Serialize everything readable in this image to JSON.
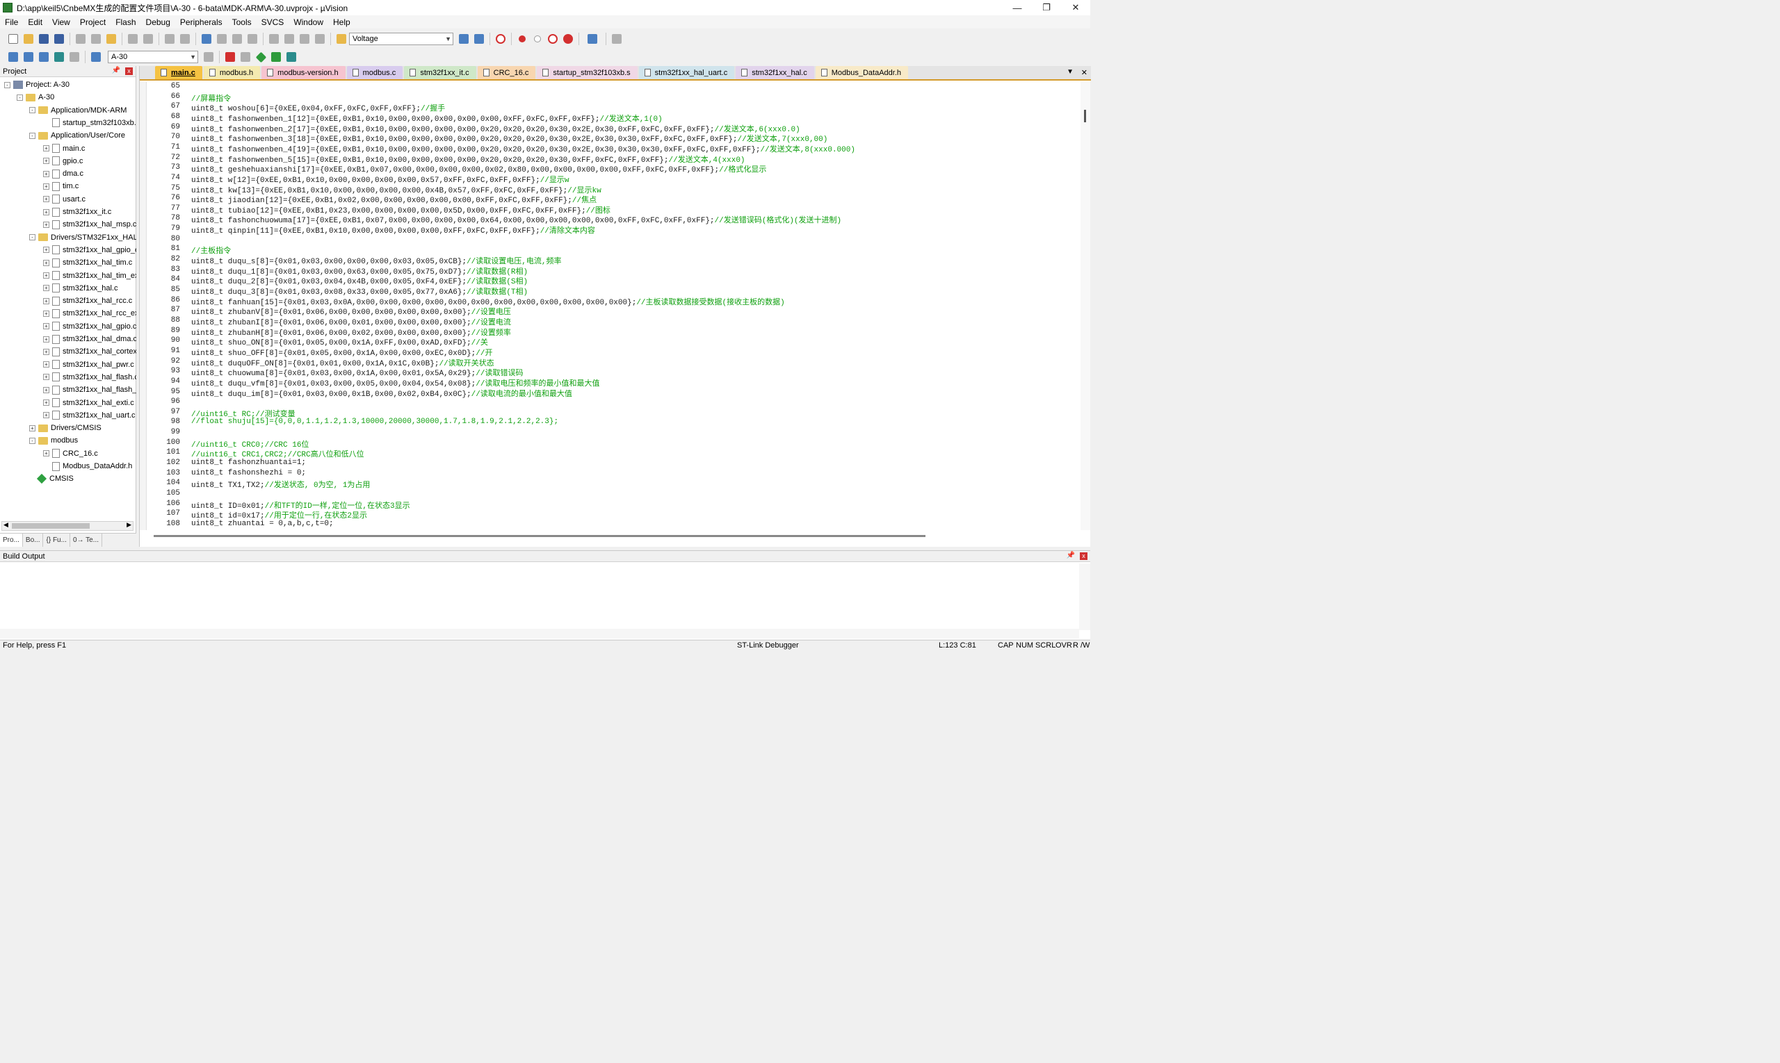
{
  "window": {
    "title": "D:\\app\\keil5\\CnbeMX生成的配置文件项目\\A-30 - 6-bata\\MDK-ARM\\A-30.uvprojx - µVision",
    "minimize": "—",
    "maximize": "❐",
    "close": "✕"
  },
  "menu": [
    "File",
    "Edit",
    "View",
    "Project",
    "Flash",
    "Debug",
    "Peripherals",
    "Tools",
    "SVCS",
    "Window",
    "Help"
  ],
  "toolbar": {
    "find_combo": "Voltage",
    "target_combo": "A-30"
  },
  "project_panel": {
    "title": "Project",
    "pin": "📌",
    "close": "x",
    "tree": [
      {
        "label": "Project: A-30",
        "level": 0,
        "type": "proj",
        "exp": "-"
      },
      {
        "label": "A-30",
        "level": 1,
        "type": "fold",
        "exp": "-"
      },
      {
        "label": "Application/MDK-ARM",
        "level": 2,
        "type": "fold",
        "exp": "-"
      },
      {
        "label": "startup_stm32f103xb.s",
        "level": 3,
        "type": "file",
        "exp": ""
      },
      {
        "label": "Application/User/Core",
        "level": 2,
        "type": "fold",
        "exp": "-"
      },
      {
        "label": "main.c",
        "level": 3,
        "type": "file",
        "exp": "+"
      },
      {
        "label": "gpio.c",
        "level": 3,
        "type": "file",
        "exp": "+"
      },
      {
        "label": "dma.c",
        "level": 3,
        "type": "file",
        "exp": "+"
      },
      {
        "label": "tim.c",
        "level": 3,
        "type": "file",
        "exp": "+"
      },
      {
        "label": "usart.c",
        "level": 3,
        "type": "file",
        "exp": "+"
      },
      {
        "label": "stm32f1xx_it.c",
        "level": 3,
        "type": "file",
        "exp": "+"
      },
      {
        "label": "stm32f1xx_hal_msp.c",
        "level": 3,
        "type": "file",
        "exp": "+"
      },
      {
        "label": "Drivers/STM32F1xx_HAL_Driver",
        "level": 2,
        "type": "fold",
        "exp": "-"
      },
      {
        "label": "stm32f1xx_hal_gpio_ex.c",
        "level": 3,
        "type": "file",
        "exp": "+"
      },
      {
        "label": "stm32f1xx_hal_tim.c",
        "level": 3,
        "type": "file",
        "exp": "+"
      },
      {
        "label": "stm32f1xx_hal_tim_ex.c",
        "level": 3,
        "type": "file",
        "exp": "+"
      },
      {
        "label": "stm32f1xx_hal.c",
        "level": 3,
        "type": "file",
        "exp": "+"
      },
      {
        "label": "stm32f1xx_hal_rcc.c",
        "level": 3,
        "type": "file",
        "exp": "+"
      },
      {
        "label": "stm32f1xx_hal_rcc_ex.c",
        "level": 3,
        "type": "file",
        "exp": "+"
      },
      {
        "label": "stm32f1xx_hal_gpio.c",
        "level": 3,
        "type": "file",
        "exp": "+"
      },
      {
        "label": "stm32f1xx_hal_dma.c",
        "level": 3,
        "type": "file",
        "exp": "+"
      },
      {
        "label": "stm32f1xx_hal_cortex.c",
        "level": 3,
        "type": "file",
        "exp": "+"
      },
      {
        "label": "stm32f1xx_hal_pwr.c",
        "level": 3,
        "type": "file",
        "exp": "+"
      },
      {
        "label": "stm32f1xx_hal_flash.c",
        "level": 3,
        "type": "file",
        "exp": "+"
      },
      {
        "label": "stm32f1xx_hal_flash_ex.c",
        "level": 3,
        "type": "file",
        "exp": "+"
      },
      {
        "label": "stm32f1xx_hal_exti.c",
        "level": 3,
        "type": "file",
        "exp": "+"
      },
      {
        "label": "stm32f1xx_hal_uart.c",
        "level": 3,
        "type": "file",
        "exp": "+"
      },
      {
        "label": "Drivers/CMSIS",
        "level": 2,
        "type": "fold",
        "exp": "+"
      },
      {
        "label": "modbus",
        "level": 2,
        "type": "fold",
        "exp": "-"
      },
      {
        "label": "CRC_16.c",
        "level": 3,
        "type": "file",
        "exp": "+"
      },
      {
        "label": "Modbus_DataAddr.h",
        "level": 3,
        "type": "file",
        "exp": ""
      },
      {
        "label": "CMSIS",
        "level": 2,
        "type": "diamond",
        "exp": ""
      }
    ],
    "tabs": [
      "Pro...",
      "Bo...",
      "{} Fu...",
      "0→ Te..."
    ]
  },
  "editor": {
    "tabs": [
      {
        "label": "main.c",
        "color": "#f5c242",
        "active": true
      },
      {
        "label": "modbus.h",
        "color": "#f4eab0"
      },
      {
        "label": "modbus-version.h",
        "color": "#f6c4d0"
      },
      {
        "label": "modbus.c",
        "color": "#d8ccee"
      },
      {
        "label": "stm32f1xx_it.c",
        "color": "#cfe8c8"
      },
      {
        "label": "CRC_16.c",
        "color": "#f8d6b0"
      },
      {
        "label": "startup_stm32f103xb.s",
        "color": "#f0d8e6"
      },
      {
        "label": "stm32f1xx_hal_uart.c",
        "color": "#d0e4ec"
      },
      {
        "label": "stm32f1xx_hal.c",
        "color": "#e2d4ec"
      },
      {
        "label": "Modbus_DataAddr.h",
        "color": "#f8eac8"
      }
    ],
    "dropdown": "▼",
    "close": "✕",
    "lines": [
      {
        "n": "65",
        "code": "",
        "comment": ""
      },
      {
        "n": "66",
        "code": "",
        "comment": "//屏幕指令"
      },
      {
        "n": "67",
        "code": "uint8_t woshou[6]={0xEE,0x04,0xFF,0xFC,0xFF,0xFF};",
        "comment": "//握手"
      },
      {
        "n": "68",
        "code": "uint8_t fashonwenben_1[12]={0xEE,0xB1,0x10,0x00,0x00,0x00,0x00,0x00,0xFF,0xFC,0xFF,0xFF};",
        "comment": "//发送文本,1(0)"
      },
      {
        "n": "69",
        "code": "uint8_t fashonwenben_2[17]={0xEE,0xB1,0x10,0x00,0x00,0x00,0x00,0x20,0x20,0x20,0x30,0x2E,0x30,0xFF,0xFC,0xFF,0xFF};",
        "comment": "//发送文本,6(xxx0.0)"
      },
      {
        "n": "70",
        "code": "uint8_t fashonwenben_3[18]={0xEE,0xB1,0x10,0x00,0x00,0x00,0x00,0x20,0x20,0x20,0x30,0x2E,0x30,0x30,0xFF,0xFC,0xFF,0xFF};",
        "comment": "//发送文本,7(xxx0,00)"
      },
      {
        "n": "71",
        "code": "uint8_t fashonwenben_4[19]={0xEE,0xB1,0x10,0x00,0x00,0x00,0x00,0x20,0x20,0x20,0x30,0x2E,0x30,0x30,0x30,0xFF,0xFC,0xFF,0xFF};",
        "comment": "//发送文本,8(xxx0.000)"
      },
      {
        "n": "72",
        "code": "uint8_t fashonwenben_5[15]={0xEE,0xB1,0x10,0x00,0x00,0x00,0x00,0x20,0x20,0x20,0x30,0xFF,0xFC,0xFF,0xFF};",
        "comment": "//发送文本,4(xxx0)"
      },
      {
        "n": "73",
        "code": "uint8_t geshehuaxianshi[17]={0xEE,0xB1,0x07,0x00,0x00,0x00,0x00,0x02,0x80,0x00,0x00,0x00,0x00,0xFF,0xFC,0xFF,0xFF};",
        "comment": "//格式化显示"
      },
      {
        "n": "74",
        "code": "uint8_t w[12]={0xEE,0xB1,0x10,0x00,0x00,0x00,0x00,0x57,0xFF,0xFC,0xFF,0xFF};",
        "comment": "//显示w"
      },
      {
        "n": "75",
        "code": "uint8_t kw[13]={0xEE,0xB1,0x10,0x00,0x00,0x00,0x00,0x4B,0x57,0xFF,0xFC,0xFF,0xFF};",
        "comment": "//显示kw"
      },
      {
        "n": "76",
        "code": "uint8_t jiaodian[12]={0xEE,0xB1,0x02,0x00,0x00,0x00,0x00,0x00,0xFF,0xFC,0xFF,0xFF};",
        "comment": "//焦点"
      },
      {
        "n": "77",
        "code": "uint8_t tubiao[12]={0xEE,0xB1,0x23,0x00,0x00,0x00,0x00,0x5D,0x00,0xFF,0xFC,0xFF,0xFF};",
        "comment": "//图标"
      },
      {
        "n": "78",
        "code": "uint8_t fashonchuowuma[17]={0xEE,0xB1,0x07,0x00,0x00,0x00,0x00,0x64,0x00,0x00,0x00,0x00,0x00,0xFF,0xFC,0xFF,0xFF};",
        "comment": "//发送错误码(格式化)(发送十进制)"
      },
      {
        "n": "79",
        "code": "uint8_t qinpin[11]={0xEE,0xB1,0x10,0x00,0x00,0x00,0x00,0xFF,0xFC,0xFF,0xFF};",
        "comment": "//清除文本内容"
      },
      {
        "n": "80",
        "code": "",
        "comment": ""
      },
      {
        "n": "81",
        "code": "",
        "comment": "//主板指令"
      },
      {
        "n": "82",
        "code": "uint8_t duqu_s[8]={0x01,0x03,0x00,0x00,0x00,0x03,0x05,0xCB};",
        "comment": "//读取设置电压,电流,频率"
      },
      {
        "n": "83",
        "code": "uint8_t duqu_1[8]={0x01,0x03,0x00,0x63,0x00,0x05,0x75,0xD7};",
        "comment": "//读取数据(R相)"
      },
      {
        "n": "84",
        "code": "uint8_t duqu_2[8]={0x01,0x03,0x04,0x4B,0x00,0x05,0xF4,0xEF};",
        "comment": "//读取数据(S相)"
      },
      {
        "n": "85",
        "code": "uint8_t duqu_3[8]={0x01,0x03,0x08,0x33,0x00,0x05,0x77,0xA6};",
        "comment": "//读取数据(T相)"
      },
      {
        "n": "86",
        "code": "uint8_t fanhuan[15]={0x01,0x03,0x0A,0x00,0x00,0x00,0x00,0x00,0x00,0x00,0x00,0x00,0x00,0x00,0x00};",
        "comment": "//主板读取数据接受数据(接收主板的数据)"
      },
      {
        "n": "87",
        "code": "uint8_t zhubanV[8]={0x01,0x06,0x00,0x00,0x00,0x00,0x00,0x00};",
        "comment": "//设置电压"
      },
      {
        "n": "88",
        "code": "uint8_t zhubanI[8]={0x01,0x06,0x00,0x01,0x00,0x00,0x00,0x00};",
        "comment": "//设置电流"
      },
      {
        "n": "89",
        "code": "uint8_t zhubanH[8]={0x01,0x06,0x00,0x02,0x00,0x00,0x00,0x00};",
        "comment": "//设置频率"
      },
      {
        "n": "90",
        "code": "uint8_t shuo_ON[8]={0x01,0x05,0x00,0x1A,0xFF,0x00,0xAD,0xFD};",
        "comment": "//关"
      },
      {
        "n": "91",
        "code": "uint8_t shuo_OFF[8]={0x01,0x05,0x00,0x1A,0x00,0x00,0xEC,0x0D};",
        "comment": "//开"
      },
      {
        "n": "92",
        "code": "uint8_t duquOFF_ON[8]={0x01,0x01,0x00,0x1A,0x1C,0x0B};",
        "comment": "//读取开关状态"
      },
      {
        "n": "93",
        "code": "uint8_t chuowuma[8]={0x01,0x03,0x00,0x1A,0x00,0x01,0x5A,0x29};",
        "comment": "//读取错误码"
      },
      {
        "n": "94",
        "code": "uint8_t duqu_vfm[8]={0x01,0x03,0x00,0x05,0x00,0x04,0x54,0x08};",
        "comment": "//读取电压和频率的最小值和最大值"
      },
      {
        "n": "95",
        "code": "uint8_t duqu_im[8]={0x01,0x03,0x00,0x1B,0x00,0x02,0xB4,0x0C};",
        "comment": "//读取电流的最小值和最大值"
      },
      {
        "n": "96",
        "code": "",
        "comment": ""
      },
      {
        "n": "97",
        "code": "",
        "comment": "//uint16_t RC;//测试变量"
      },
      {
        "n": "98",
        "code": "",
        "comment": "//float shuju[15]={0,0,0,1.1,1.2,1.3,10000,20000,30000,1.7,1.8,1.9,2.1,2.2,2.3};"
      },
      {
        "n": "99",
        "code": "",
        "comment": ""
      },
      {
        "n": "100",
        "code": "",
        "comment": "//uint16_t CRC0;//CRC 16位"
      },
      {
        "n": "101",
        "code": "",
        "comment": "//uint16_t CRC1,CRC2;//CRC高八位和低八位"
      },
      {
        "n": "102",
        "code": "uint8_t fashonzhuantai=1;",
        "comment": ""
      },
      {
        "n": "103",
        "code": "uint8_t fashonshezhi = 0;",
        "comment": ""
      },
      {
        "n": "104",
        "code": "uint8_t TX1,TX2;",
        "comment": "//发送状态, 0为空, 1为占用"
      },
      {
        "n": "105",
        "code": "",
        "comment": ""
      },
      {
        "n": "106",
        "code": "uint8_t ID=0x01;",
        "comment": "//和TFT的ID一样,定位一位,在状态3显示"
      },
      {
        "n": "107",
        "code": "uint8_t id=0x17;",
        "comment": "//用于定位一行,在状态2显示"
      },
      {
        "n": "108",
        "code": "uint8_t zhuantai = 0,a,b,c,t=0;",
        "comment": ""
      }
    ]
  },
  "build_output": {
    "title": "Build Output"
  },
  "status": {
    "help": "For Help, press F1",
    "debugger": "ST-Link Debugger",
    "position": "L:123 C:81",
    "caps": "CAP",
    "num": "NUM",
    "scrl": "SCRL",
    "ovr": "OVR",
    "rw": "R /W"
  }
}
